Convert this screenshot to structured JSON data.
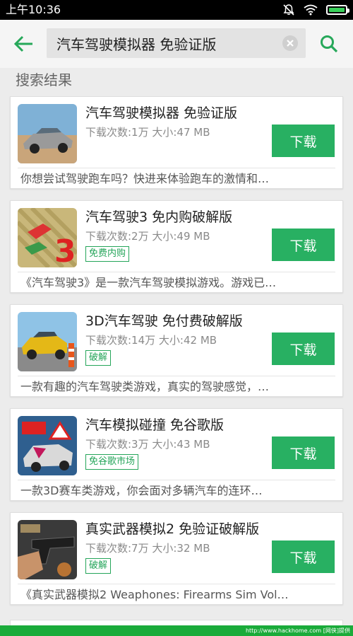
{
  "status_bar": {
    "time": "上午10:36",
    "battery_level": 1.0
  },
  "toolbar": {
    "search_value": "汽车驾驶模拟器 免验证版"
  },
  "section_title": "搜索结果",
  "download_label": "下载",
  "apps": [
    {
      "name": "汽车驾驶模拟器 免验证版",
      "meta": "下载次数:1万  大小:47 MB",
      "badge": "",
      "desc": "你想尝试驾驶跑车吗？快进来体验跑车的激情和…"
    },
    {
      "name": "汽车驾驶3 免内购破解版",
      "meta": "下载次数:2万  大小:49 MB",
      "badge": "免费内购",
      "desc": "《汽车驾驶3》是一款汽车驾驶模拟游戏。游戏已…"
    },
    {
      "name": "3D汽车驾驶 免付费破解版",
      "meta": "下载次数:14万  大小:42 MB",
      "badge": "破解",
      "desc": "一款有趣的汽车驾驶类游戏，真实的驾驶感觉，…"
    },
    {
      "name": "汽车模拟碰撞 免谷歌版",
      "meta": "下载次数:3万  大小:43 MB",
      "badge": "免谷歌市场",
      "desc": "一款3D赛车类游戏，你会面对多辆汽车的连环…"
    },
    {
      "name": "真实武器模拟2 免验证破解版",
      "meta": "下载次数:7万  大小:32 MB",
      "badge": "破解",
      "desc": "《真实武器模拟2 Weaphones: Firearms Sim Vol…"
    }
  ],
  "watermark": "http://www.hackhome.com [网侠]提供",
  "colors": {
    "accent": "#28b062",
    "icon_green": "#27a85a",
    "status_bar": "#000000",
    "bottom_bar": "#1aab3a"
  }
}
